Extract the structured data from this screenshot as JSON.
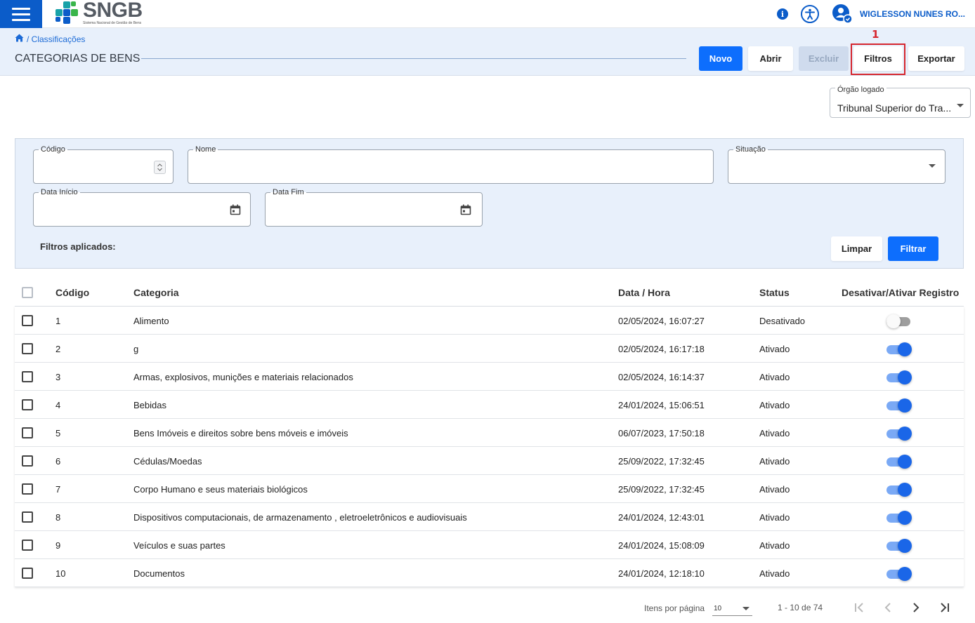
{
  "app": {
    "logo_title": "SNGB",
    "logo_subtitle": "Sistema Nacional de Gestão de Bens",
    "user_name": "WIGLESSON NUNES RO...",
    "brand_color": "#0b5cc9"
  },
  "header": {
    "breadcrumb": "/ Classificações",
    "title": "CATEGORIAS DE BENS",
    "buttons": {
      "novo": "Novo",
      "abrir": "Abrir",
      "excluir": "Excluir",
      "filtros": "Filtros",
      "exportar": "Exportar"
    },
    "highlight_number": "1"
  },
  "org": {
    "label": "Órgão logado",
    "value": "Tribunal Superior do Tra..."
  },
  "filters": {
    "codigo_label": "Código",
    "nome_label": "Nome",
    "situacao_label": "Situação",
    "data_inicio_label": "Data Início",
    "data_fim_label": "Data Fim",
    "applied_label": "Filtros aplicados:",
    "limpar": "Limpar",
    "filtrar": "Filtrar"
  },
  "table": {
    "headers": {
      "codigo": "Código",
      "categoria": "Categoria",
      "data_hora": "Data / Hora",
      "status": "Status",
      "toggle": "Desativar/Ativar Registro"
    },
    "rows": [
      {
        "codigo": "1",
        "categoria": "Alimento",
        "data_hora": "02/05/2024, 16:07:27",
        "status": "Desativado",
        "active": false
      },
      {
        "codigo": "2",
        "categoria": "g",
        "data_hora": "02/05/2024, 16:17:18",
        "status": "Ativado",
        "active": true
      },
      {
        "codigo": "3",
        "categoria": "Armas, explosivos, munições e materiais relacionados",
        "data_hora": "02/05/2024, 16:14:37",
        "status": "Ativado",
        "active": true
      },
      {
        "codigo": "4",
        "categoria": "Bebidas",
        "data_hora": "24/01/2024, 15:06:51",
        "status": "Ativado",
        "active": true
      },
      {
        "codigo": "5",
        "categoria": "Bens Imóveis e direitos sobre bens móveis e imóveis",
        "data_hora": "06/07/2023, 17:50:18",
        "status": "Ativado",
        "active": true
      },
      {
        "codigo": "6",
        "categoria": "Cédulas/Moedas",
        "data_hora": "25/09/2022, 17:32:45",
        "status": "Ativado",
        "active": true
      },
      {
        "codigo": "7",
        "categoria": "Corpo Humano e seus materiais biológicos",
        "data_hora": "25/09/2022, 17:32:45",
        "status": "Ativado",
        "active": true
      },
      {
        "codigo": "8",
        "categoria": "Dispositivos computacionais, de armazenamento , eletroeletrônicos e audiovisuais",
        "data_hora": "24/01/2024, 12:43:01",
        "status": "Ativado",
        "active": true
      },
      {
        "codigo": "9",
        "categoria": "Veículos e suas partes",
        "data_hora": "24/01/2024, 15:08:09",
        "status": "Ativado",
        "active": true
      },
      {
        "codigo": "10",
        "categoria": "Documentos",
        "data_hora": "24/01/2024, 12:18:10",
        "status": "Ativado",
        "active": true
      }
    ]
  },
  "paginator": {
    "items_label": "Itens por página",
    "page_size": "10",
    "range": "1 - 10 de 74"
  },
  "colors": {
    "primary": "#0d6efd",
    "toggle_on_track": "#7aa9f5",
    "toggle_on_thumb": "#1a66e8",
    "toggle_off_track": "#9e9e9e",
    "toggle_off_thumb": "#fafafa",
    "highlight": "#d6262e"
  }
}
